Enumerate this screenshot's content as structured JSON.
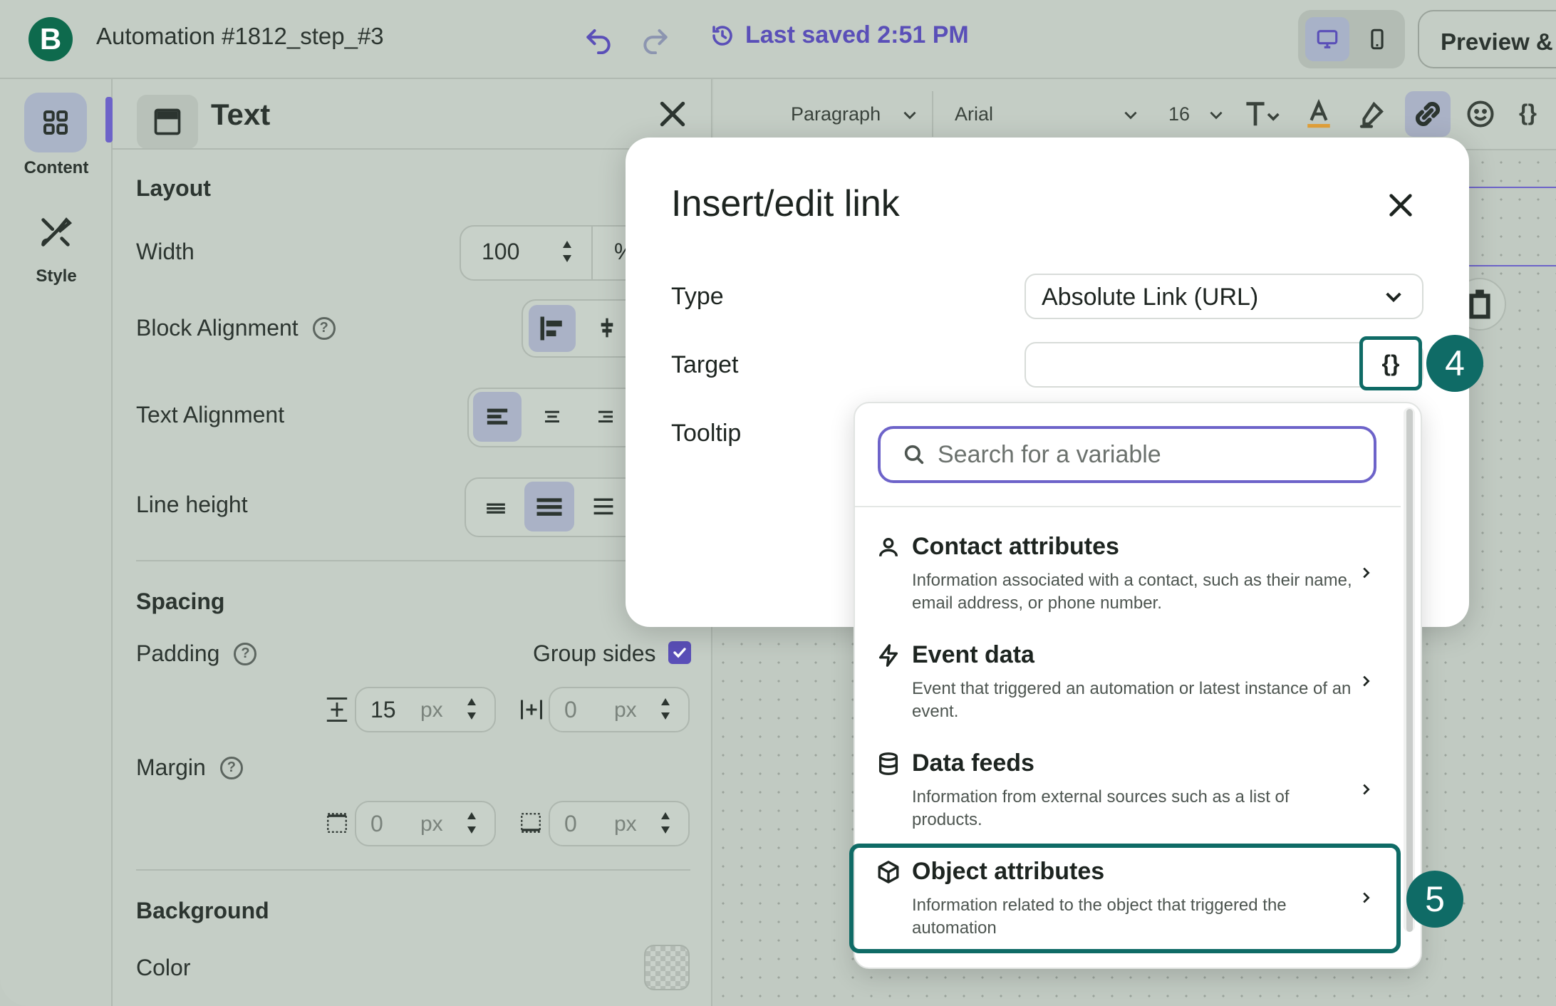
{
  "header": {
    "logo_letter": "B",
    "title": "Automation #1812_step_#3",
    "last_saved": "Last saved 2:51 PM",
    "preview_label": "Preview & t"
  },
  "rail": {
    "items": [
      {
        "label": "Content",
        "icon": "grid-icon"
      },
      {
        "label": "Style",
        "icon": "brush-icon"
      }
    ]
  },
  "panel": {
    "title": "Text",
    "layout": {
      "heading": "Layout",
      "width_label": "Width",
      "width_value": "100",
      "width_unit": "%",
      "block_alignment_label": "Block Alignment",
      "text_alignment_label": "Text Alignment",
      "line_height_label": "Line height"
    },
    "spacing": {
      "heading": "Spacing",
      "padding_label": "Padding",
      "group_sides_label": "Group sides",
      "padding_vertical": "15",
      "padding_horizontal": "0",
      "margin_label": "Margin",
      "margin_top": "0",
      "margin_bottom": "0",
      "unit": "px"
    },
    "background": {
      "heading": "Background",
      "color_label": "Color"
    }
  },
  "toolbar": {
    "block_type": "Paragraph",
    "font": "Arial",
    "font_size": "16",
    "variables_label": "{}"
  },
  "modal": {
    "title": "Insert/edit link",
    "type_label": "Type",
    "type_value": "Absolute Link (URL)",
    "target_label": "Target",
    "target_value": "",
    "tooltip_label": "Tooltip",
    "variable_button_label": "{}"
  },
  "dropdown": {
    "search_placeholder": "Search for a variable",
    "items": [
      {
        "title": "Contact attributes",
        "description": "Information associated with a contact, such as their name, email address, or phone number.",
        "icon": "person-icon"
      },
      {
        "title": "Event data",
        "description": "Event that triggered an automation or latest instance of an event.",
        "icon": "bolt-icon"
      },
      {
        "title": "Data feeds",
        "description": "Information from external sources such as a list of products.",
        "icon": "database-icon"
      },
      {
        "title": "Object attributes",
        "description": "Information related to the object that triggered the automation",
        "icon": "cube-icon"
      }
    ]
  },
  "annotations": {
    "step4": "4",
    "step5": "5"
  },
  "colors": {
    "accent": "#5a4fb8",
    "brand": "#0e6a4d",
    "annotation": "#0f6b66"
  }
}
